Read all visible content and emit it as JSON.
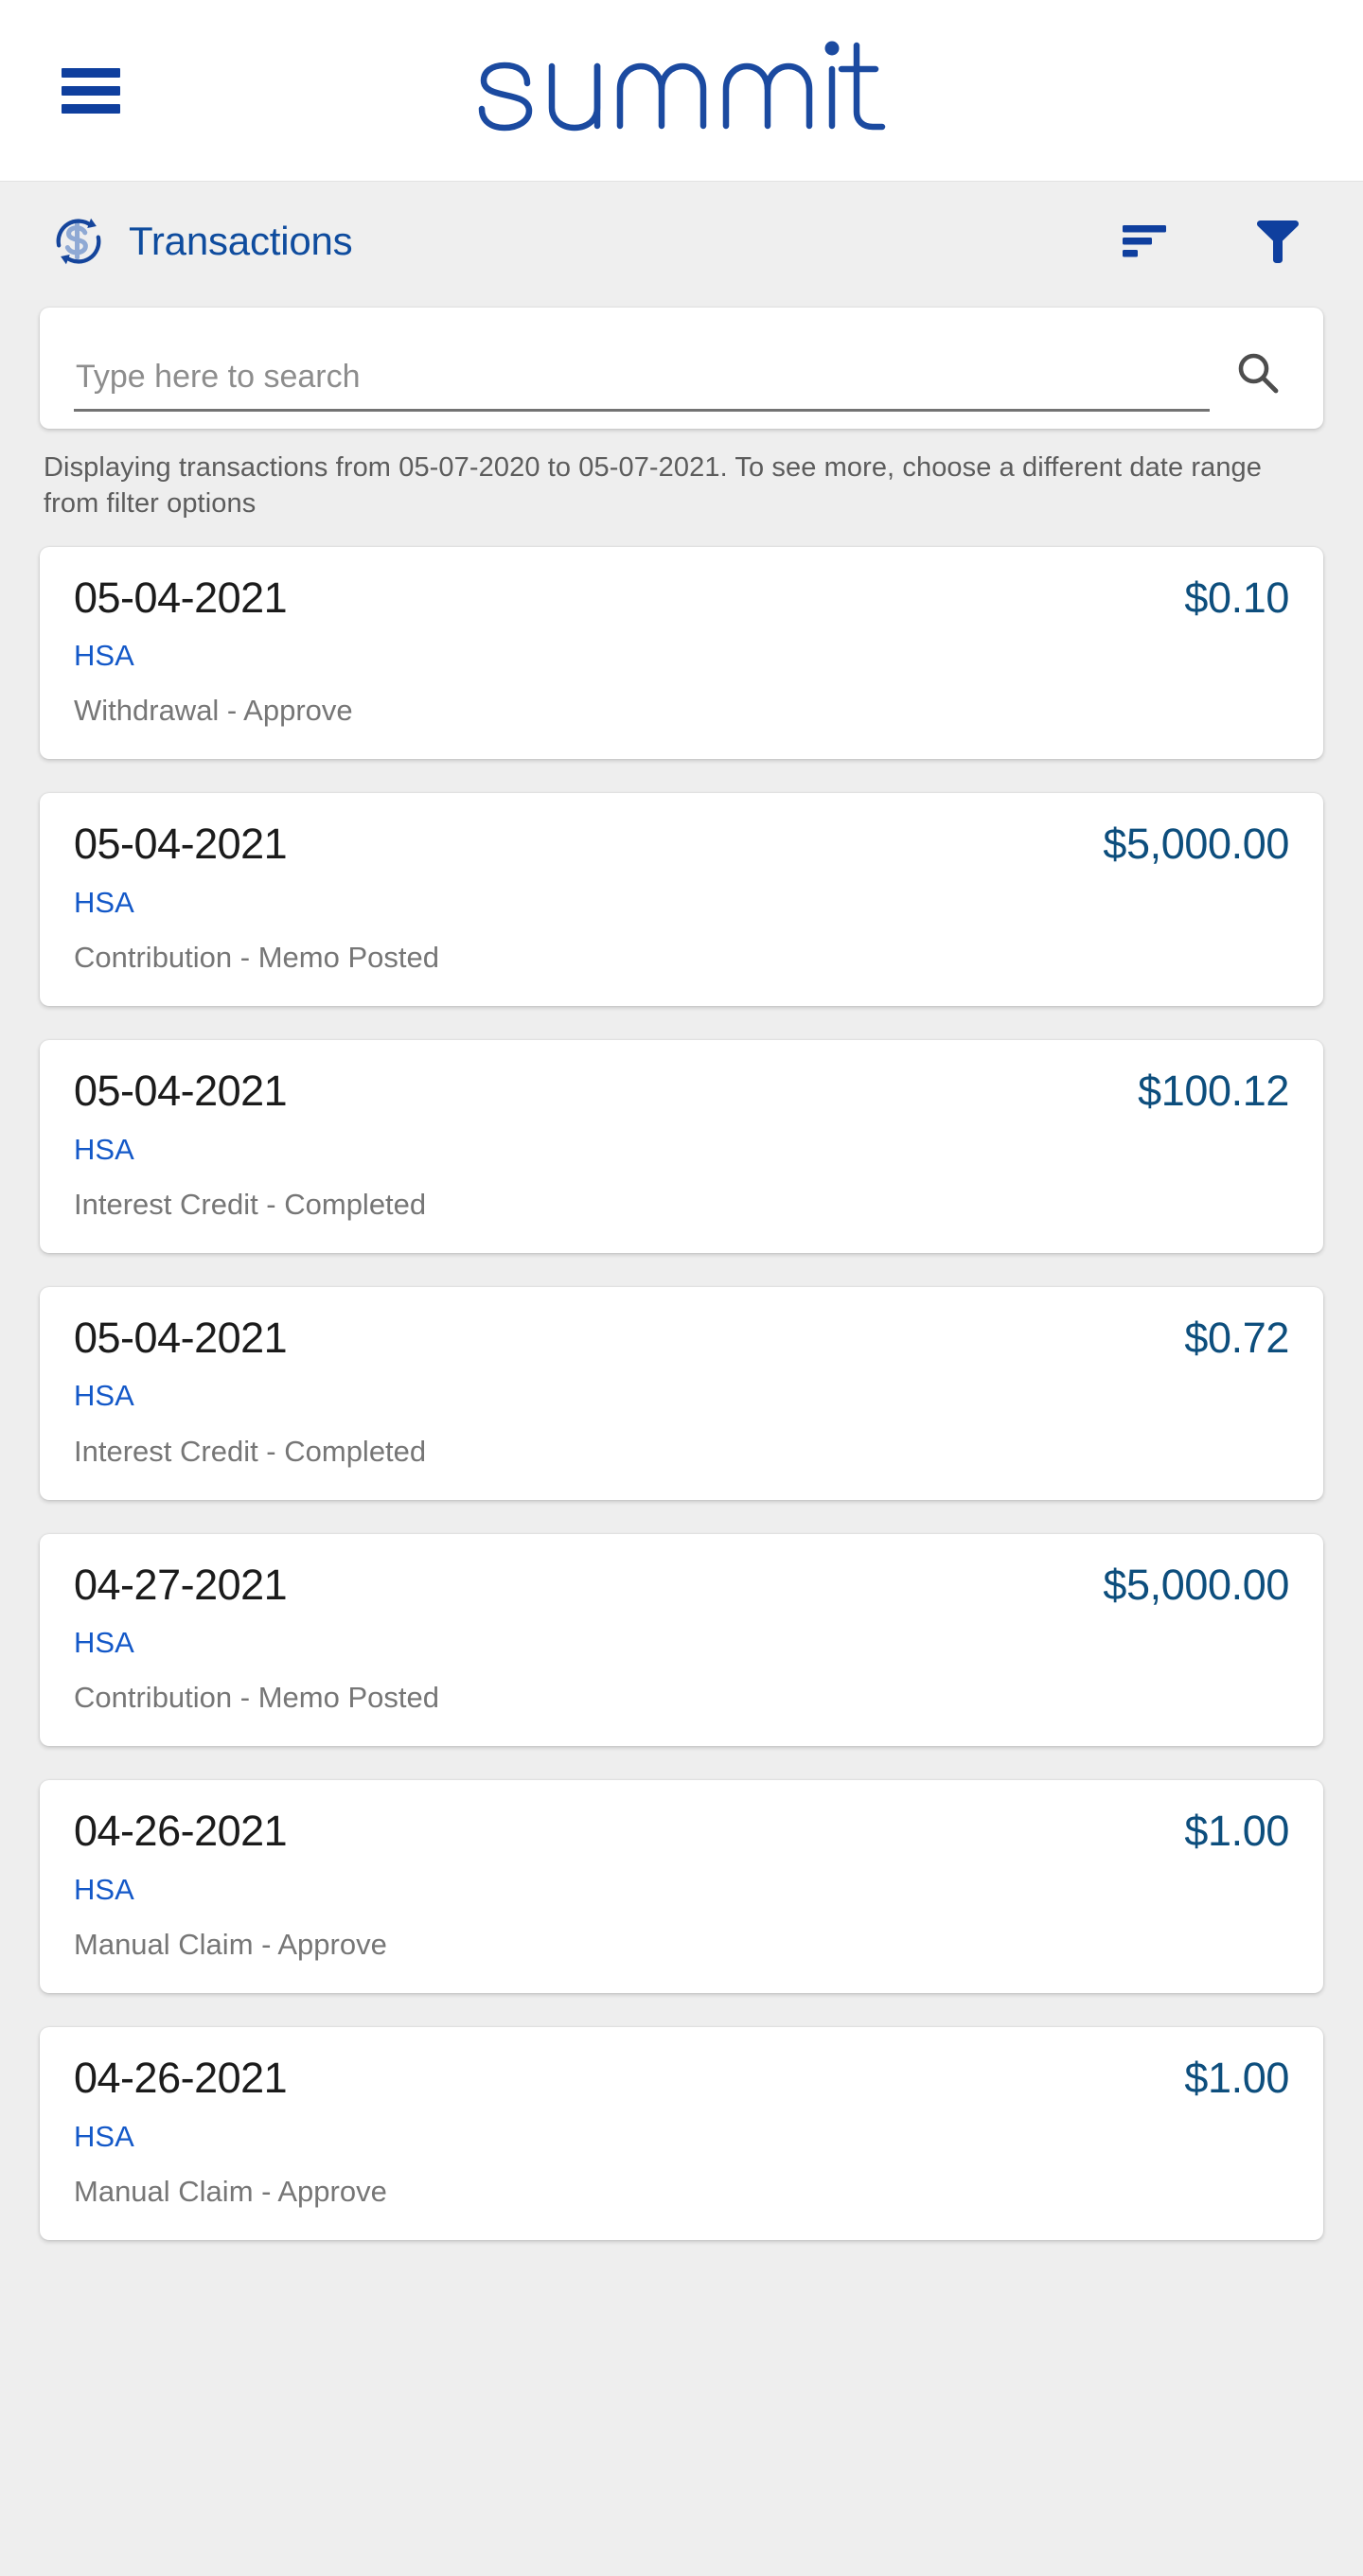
{
  "topbar": {
    "menu_icon": "hamburger-menu-icon",
    "brand_name": "summit",
    "brand_color": "#1b4aa0"
  },
  "page_header": {
    "title": "Transactions",
    "title_color": "#0f4c9e",
    "icon": "transactions-cycle-dollar-icon",
    "sort_icon": "sort-icon",
    "filter_icon": "filter-funnel-icon"
  },
  "search": {
    "placeholder": "Type here to search",
    "value": "",
    "icon": "search-magnifier-icon"
  },
  "date_range_note": "Displaying transactions from 05-07-2020 to 05-07-2021. To see more, choose a different date range from filter options",
  "colors": {
    "brand_blue": "#0f3f9e",
    "amount_blue": "#0d4e7d",
    "link_blue": "#1358c8",
    "muted_gray": "#767676",
    "page_background": "#eeeeee",
    "card_background": "#ffffff"
  },
  "transactions": [
    {
      "date": "05-04-2021",
      "amount": "$0.10",
      "account": "HSA",
      "description": "Withdrawal - Approve"
    },
    {
      "date": "05-04-2021",
      "amount": "$5,000.00",
      "account": "HSA",
      "description": "Contribution - Memo Posted"
    },
    {
      "date": "05-04-2021",
      "amount": "$100.12",
      "account": "HSA",
      "description": "Interest Credit - Completed"
    },
    {
      "date": "05-04-2021",
      "amount": "$0.72",
      "account": "HSA",
      "description": "Interest Credit - Completed"
    },
    {
      "date": "04-27-2021",
      "amount": "$5,000.00",
      "account": "HSA",
      "description": "Contribution - Memo Posted"
    },
    {
      "date": "04-26-2021",
      "amount": "$1.00",
      "account": "HSA",
      "description": "Manual Claim - Approve"
    },
    {
      "date": "04-26-2021",
      "amount": "$1.00",
      "account": "HSA",
      "description": "Manual Claim - Approve"
    }
  ]
}
